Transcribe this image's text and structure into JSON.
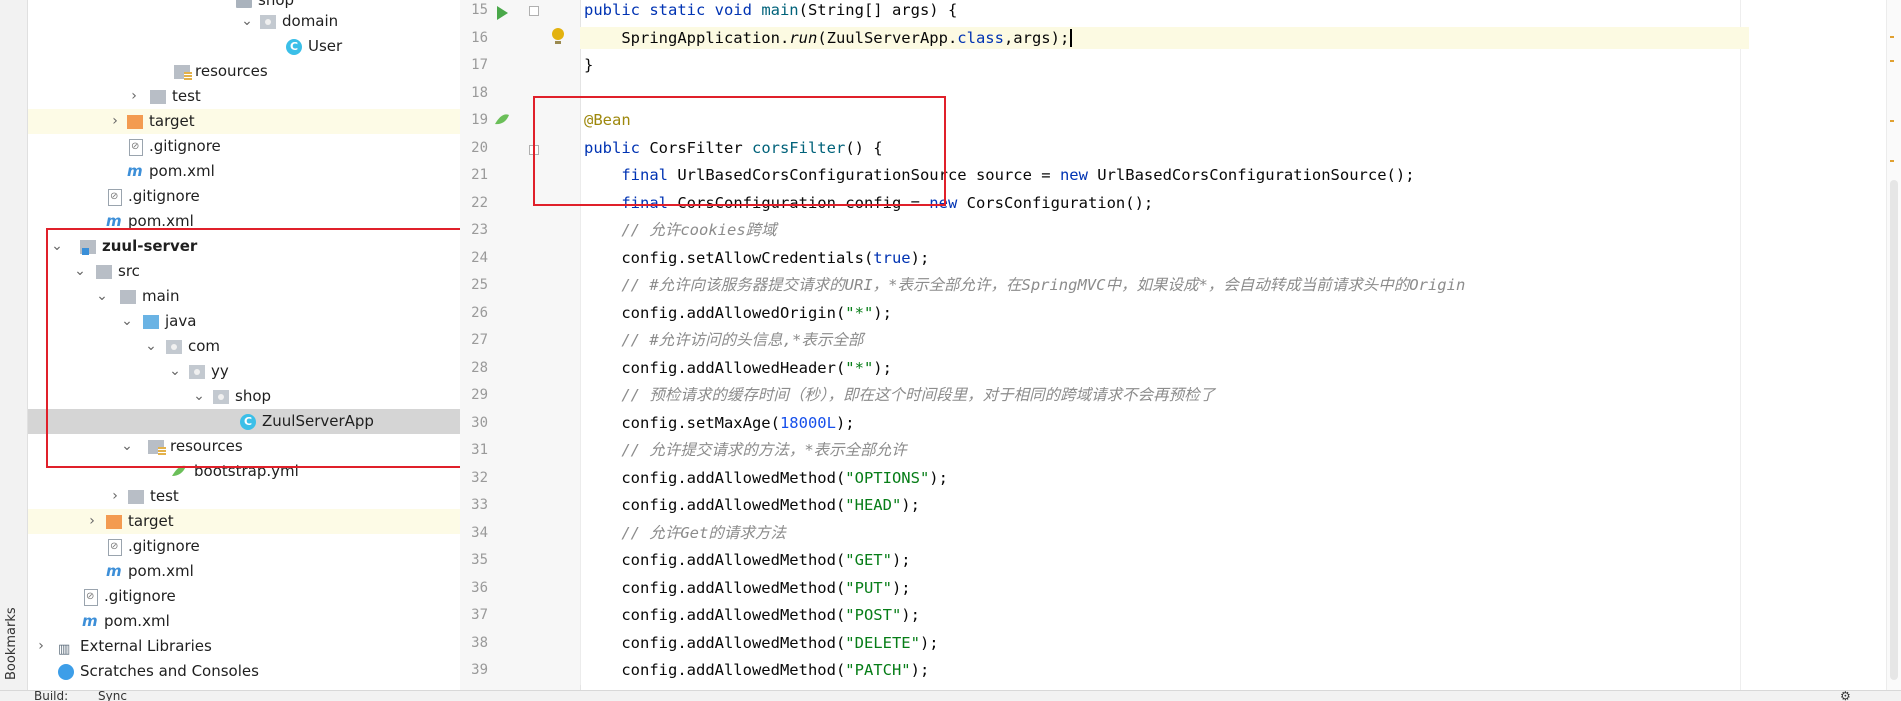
{
  "left_strip": {
    "label": "Bookmarks"
  },
  "project_tree": {
    "items": [
      {
        "label": "shop",
        "depth": 9
      },
      {
        "label": "domain",
        "depth": 10
      },
      {
        "label": "User",
        "depth": 11
      },
      {
        "label": "resources",
        "depth": 7
      },
      {
        "label": "test",
        "depth": 6
      },
      {
        "label": "target",
        "depth": 5
      },
      {
        "label": ".gitignore",
        "depth": 5
      },
      {
        "label": "pom.xml",
        "depth": 5
      },
      {
        "label": ".gitignore",
        "depth": 4
      },
      {
        "label": "pom.xml",
        "depth": 4
      },
      {
        "label": "zuul-server",
        "depth": 2
      },
      {
        "label": "src",
        "depth": 3
      },
      {
        "label": "main",
        "depth": 4
      },
      {
        "label": "java",
        "depth": 5
      },
      {
        "label": "com",
        "depth": 6
      },
      {
        "label": "yy",
        "depth": 7
      },
      {
        "label": "shop",
        "depth": 8
      },
      {
        "label": "ZuulServerApp",
        "depth": 10
      },
      {
        "label": "resources",
        "depth": 5
      },
      {
        "label": "bootstrap.yml",
        "depth": 7
      },
      {
        "label": "test",
        "depth": 4
      },
      {
        "label": "target",
        "depth": 3
      },
      {
        "label": ".gitignore",
        "depth": 3
      },
      {
        "label": "pom.xml",
        "depth": 3
      },
      {
        "label": ".gitignore",
        "depth": 2
      },
      {
        "label": "pom.xml",
        "depth": 2
      },
      {
        "label": "External Libraries",
        "depth": 1
      },
      {
        "label": "Scratches and Consoles",
        "depth": 1
      }
    ]
  },
  "editor": {
    "line_numbers": [
      "15",
      "16",
      "17",
      "18",
      "19",
      "20",
      "21",
      "22",
      "23",
      "24",
      "25",
      "26",
      "27",
      "28",
      "29",
      "30",
      "31",
      "32",
      "33",
      "34",
      "35",
      "36",
      "37",
      "38",
      "39"
    ],
    "lines": {
      "l15_a": "public static void ",
      "l15_b": "main",
      "l15_c": "(String[] args) {",
      "l16_a": "    SpringApplication.",
      "l16_b": "run",
      "l16_c": "(ZuulServerApp.",
      "l16_d": "class",
      "l16_e": ",args);",
      "l17": "}",
      "l19": "@Bean",
      "l20_a": "public ",
      "l20_b": "CorsFilter ",
      "l20_c": "corsFilter",
      "l20_d": "() {",
      "l21_a": "    final ",
      "l21_b": "UrlBasedCorsConfigurationSource source = ",
      "l21_c": "new ",
      "l21_d": "UrlBasedCorsConfigurationSource();",
      "l22_a": "    final ",
      "l22_b": "CorsConfiguration config = ",
      "l22_c": "new ",
      "l22_d": "CorsConfiguration();",
      "l23": "    // 允许cookies跨域",
      "l24_a": "    config.setAllowCredentials(",
      "l24_b": "true",
      "l24_c": ");",
      "l25": "    // #允许向该服务器提交请求的URI，*表示全部允许，在SpringMVC中，如果设成*，会自动转成当前请求头中的Origin",
      "l26_a": "    config.addAllowedOrigin(",
      "l26_b": "\"*\"",
      "l26_c": ");",
      "l27": "    // #允许访问的头信息,*表示全部",
      "l28_a": "    config.addAllowedHeader(",
      "l28_b": "\"*\"",
      "l28_c": ");",
      "l29": "    // 预检请求的缓存时间（秒），即在这个时间段里，对于相同的跨域请求不会再预检了",
      "l30_a": "    config.setMaxAge(",
      "l30_b": "18000L",
      "l30_c": ");",
      "l31": "    // 允许提交请求的方法，*表示全部允许",
      "l32_a": "    config.addAllowedMethod(",
      "l32_b": "\"OPTIONS\"",
      "l32_c": ");",
      "l33_a": "    config.addAllowedMethod(",
      "l33_b": "\"HEAD\"",
      "l33_c": ");",
      "l34": "    // 允许Get的请求方法",
      "l35_a": "    config.addAllowedMethod(",
      "l35_b": "\"GET\"",
      "l35_c": ");",
      "l36_a": "    config.addAllowedMethod(",
      "l36_b": "\"PUT\"",
      "l36_c": ");",
      "l37_a": "    config.addAllowedMethod(",
      "l37_b": "\"POST\"",
      "l37_c": ");",
      "l38_a": "    config.addAllowedMethod(",
      "l38_b": "\"DELETE\"",
      "l38_c": ");",
      "l39_a": "    config.addAllowedMethod(",
      "l39_b": "\"PATCH\"",
      "l39_c": ");"
    }
  },
  "bottom_bar": {
    "build": "Build:",
    "sync": "Sync"
  },
  "colors": {
    "highlight_box": "#e0202a",
    "keyword": "#0033b3",
    "string": "#067d17",
    "comment": "#8c8c8c",
    "annotation": "#9e880d"
  }
}
